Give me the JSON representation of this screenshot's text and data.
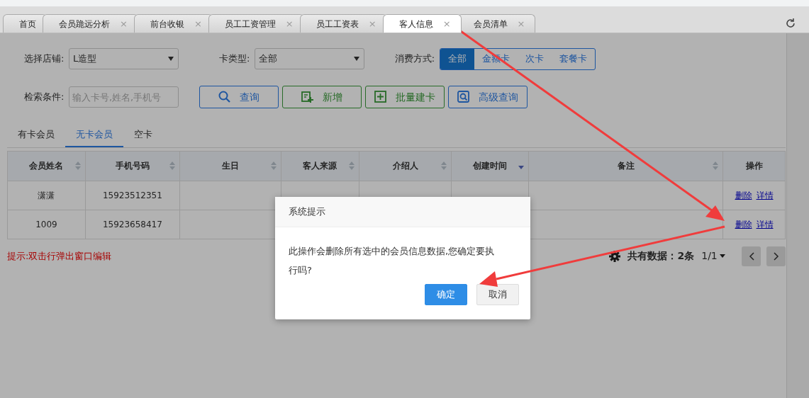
{
  "tabs": [
    {
      "label": "首页",
      "selected": false,
      "closable": false
    },
    {
      "label": "会员跪远分析",
      "selected": false,
      "closable": true
    },
    {
      "label": "前台收银",
      "selected": false,
      "closable": true
    },
    {
      "label": "员工工资管理",
      "selected": false,
      "closable": true
    },
    {
      "label": "员工工资表",
      "selected": false,
      "closable": true
    },
    {
      "label": "客人信息",
      "selected": true,
      "closable": true
    },
    {
      "label": "会员清单",
      "selected": false,
      "closable": true
    }
  ],
  "close_mark": "×",
  "filters": {
    "store": {
      "label": "选择店铺:",
      "value": "L造型"
    },
    "card_type": {
      "label": "卡类型:",
      "value": "全部"
    },
    "pay_mode": {
      "label": "消费方式:",
      "options": [
        {
          "label": "全部",
          "selected": true
        },
        {
          "label": "金额卡",
          "selected": false
        },
        {
          "label": "次卡",
          "selected": false
        },
        {
          "label": "套餐卡",
          "selected": false
        }
      ]
    },
    "search": {
      "label": "检索条件:",
      "placeholder": "输入卡号,姓名,手机号"
    }
  },
  "buttons": [
    {
      "label": "查询",
      "kind": "search"
    },
    {
      "label": "新增",
      "kind": "add"
    },
    {
      "label": "批量建卡",
      "kind": "batch"
    },
    {
      "label": "高级查询",
      "kind": "advanced"
    }
  ],
  "member_tabs": [
    {
      "label": "有卡会员",
      "selected": false
    },
    {
      "label": "无卡会员",
      "selected": true
    },
    {
      "label": "空卡",
      "selected": false
    }
  ],
  "table": {
    "columns": [
      {
        "label": "会员姓名",
        "sortable": true,
        "sorted_desc": false
      },
      {
        "label": "手机号码",
        "sortable": true,
        "sorted_desc": false
      },
      {
        "label": "生日",
        "sortable": true,
        "sorted_desc": false
      },
      {
        "label": "客人来源",
        "sortable": true,
        "sorted_desc": false
      },
      {
        "label": "介绍人",
        "sortable": true,
        "sorted_desc": false
      },
      {
        "label": "创建时间",
        "sortable": true,
        "sorted_desc": true
      },
      {
        "label": "备注",
        "sortable": true,
        "sorted_desc": false
      },
      {
        "label": "操作",
        "sortable": false
      }
    ],
    "rows": [
      {
        "cells": [
          "潇潇",
          "15923512351",
          "",
          "",
          "",
          "",
          ""
        ],
        "actions": [
          "删除",
          "详情"
        ]
      },
      {
        "cells": [
          "1009",
          "15923658417",
          "",
          "",
          "",
          "",
          ""
        ],
        "actions": [
          "删除",
          "详情"
        ]
      }
    ]
  },
  "hint": "提示:双击行弹出窗口编辑",
  "footer": {
    "total": "共有数据：2条",
    "page": "1/1"
  },
  "dialog": {
    "title": "系统提示",
    "message": "此操作会删除所有选中的会员信息数据,您确定要执行吗?",
    "buttons": [
      {
        "label": "确定",
        "kind": "primary"
      },
      {
        "label": "取消",
        "kind": "secondary"
      }
    ]
  }
}
